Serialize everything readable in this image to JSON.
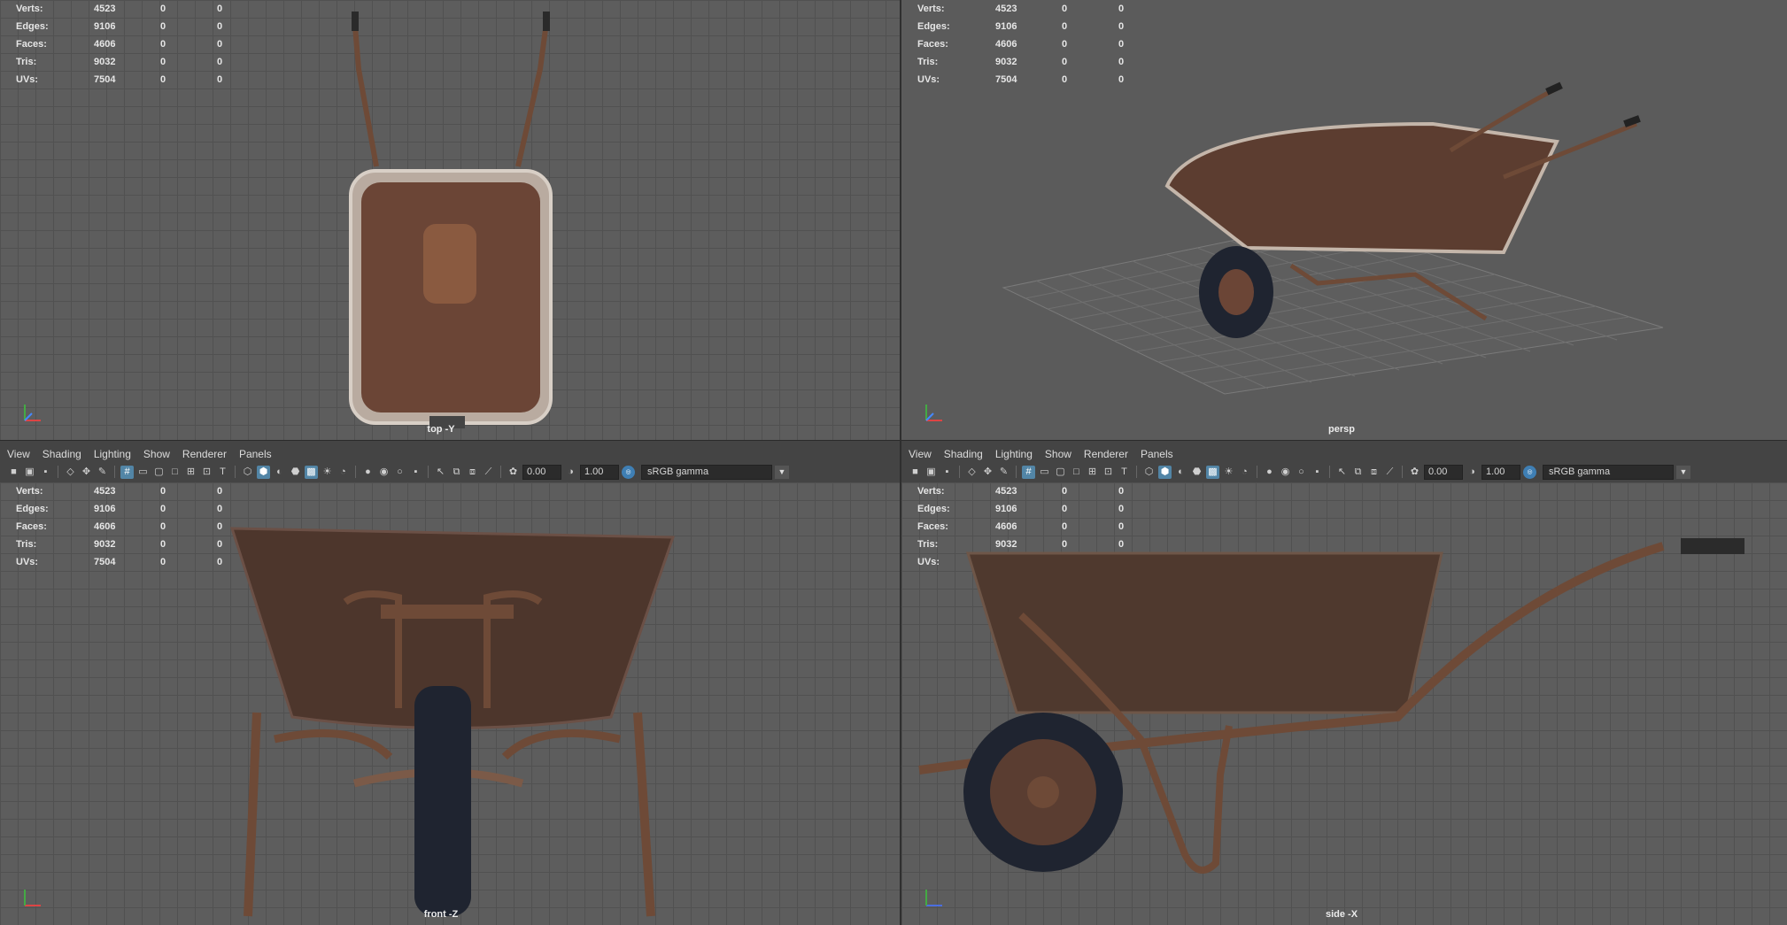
{
  "stats": [
    {
      "label": "Verts:",
      "v1": "4523",
      "v2": "0",
      "v3": "0"
    },
    {
      "label": "Edges:",
      "v1": "9106",
      "v2": "0",
      "v3": "0"
    },
    {
      "label": "Faces:",
      "v1": "4606",
      "v2": "0",
      "v3": "0"
    },
    {
      "label": "Tris:",
      "v1": "9032",
      "v2": "0",
      "v3": "0"
    },
    {
      "label": "UVs:",
      "v1": "7504",
      "v2": "0",
      "v3": "0"
    }
  ],
  "viewports": {
    "top": {
      "label": "top -Y"
    },
    "persp": {
      "label": "persp"
    },
    "front": {
      "label": "front -Z"
    },
    "side": {
      "label": "side -X"
    }
  },
  "panel_menu": [
    "View",
    "Shading",
    "Lighting",
    "Show",
    "Renderer",
    "Panels"
  ],
  "toolbar": {
    "exposure": "0.00",
    "gamma": "1.00",
    "color_space": "sRGB gamma"
  }
}
